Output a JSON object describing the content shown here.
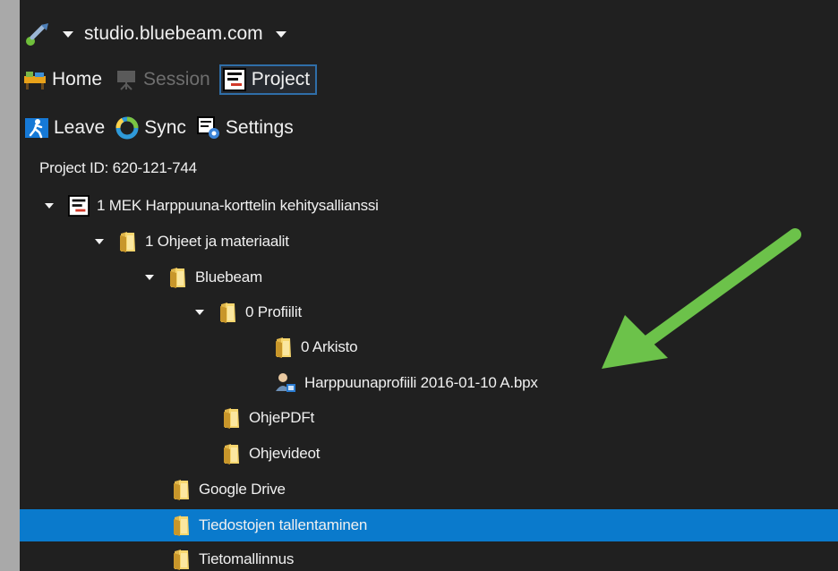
{
  "header": {
    "server": "studio.bluebeam.com"
  },
  "toolbar1": [
    {
      "label": "Home",
      "state": "normal"
    },
    {
      "label": "Session",
      "state": "disabled"
    },
    {
      "label": "Project",
      "state": "active"
    }
  ],
  "toolbar2": [
    {
      "label": "Leave"
    },
    {
      "label": "Sync"
    },
    {
      "label": "Settings"
    }
  ],
  "project_id": "Project ID: 620-121-744",
  "tree": {
    "project": "1 MEK Harppuuna-korttelin kehitysallianssi",
    "folder_ohjeet": "1 Ohjeet ja materiaalit",
    "folder_bluebeam": "Bluebeam",
    "folder_profiilit": "0 Profiilit",
    "folder_arkisto": "0 Arkisto",
    "file_profile": "Harppuunaprofiili 2016-01-10 A.bpx",
    "folder_ohjepdf": "OhjePDFt",
    "folder_ohjevideot": "Ohjevideot",
    "folder_google": "Google Drive",
    "folder_tallentaminen": "Tiedostojen tallentaminen",
    "folder_tietomallinnus": "Tietomallinnus"
  },
  "colors": {
    "selection": "#0a7acc",
    "annotation_arrow": "#6cc24a",
    "background": "#202020"
  }
}
